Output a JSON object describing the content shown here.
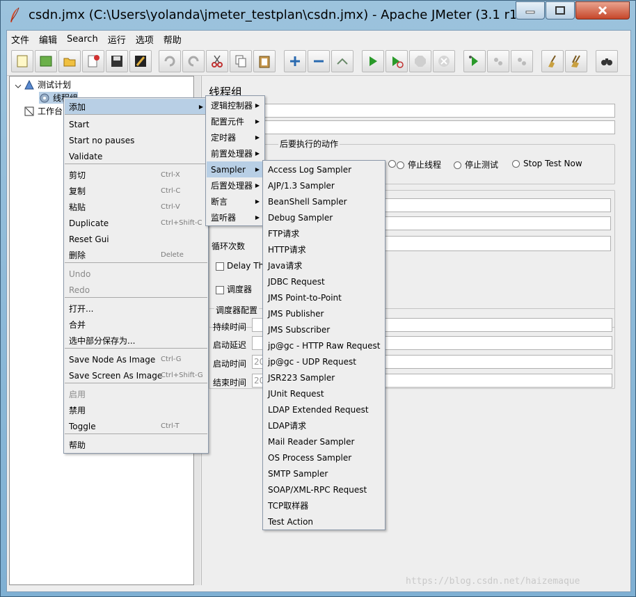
{
  "window": {
    "title": "csdn.jmx (C:\\Users\\yolanda\\jmeter_testplan\\csdn.jmx) - Apache JMeter (3.1 r17..."
  },
  "menubar": [
    "文件",
    "编辑",
    "Search",
    "运行",
    "选项",
    "帮助"
  ],
  "tree": {
    "items": [
      {
        "label": "测试计划",
        "icon": "test-plan-icon"
      },
      {
        "label": "线程组",
        "icon": "gear-icon"
      },
      {
        "label": "工作台",
        "icon": "workbench-icon"
      }
    ]
  },
  "panel": {
    "title": "线程组",
    "error_action_label": "后要执行的动作",
    "radio_options": [
      "停止线程",
      "停止测试",
      "Stop Test Now"
    ],
    "loop_label": "循环次数",
    "delay_label": "Delay Thr",
    "scheduler_label": "调度器",
    "scheduler_config": "调度器配置",
    "duration_label": "持续时间（秒",
    "startup_delay_label": "启动延迟（秒",
    "start_time_label": "启动时间",
    "start_time_value": "20",
    "end_time_label": "结束时间",
    "end_time_value": "20"
  },
  "context_menu": {
    "items": [
      {
        "label": "添加",
        "sc": "",
        "arrow": true,
        "hl": true
      },
      {
        "label": "Start",
        "sc": ""
      },
      {
        "label": "Start no pauses",
        "sc": ""
      },
      {
        "label": "Validate",
        "sc": ""
      },
      {
        "label": "剪切",
        "sc": "Ctrl-X"
      },
      {
        "label": "复制",
        "sc": "Ctrl-C"
      },
      {
        "label": "粘贴",
        "sc": "Ctrl-V"
      },
      {
        "label": "Duplicate",
        "sc": "Ctrl+Shift-C"
      },
      {
        "label": "Reset Gui",
        "sc": ""
      },
      {
        "label": "删除",
        "sc": "Delete"
      },
      {
        "label": "Undo",
        "sc": "",
        "disabled": true
      },
      {
        "label": "Redo",
        "sc": "",
        "disabled": true
      },
      {
        "label": "打开...",
        "sc": ""
      },
      {
        "label": "合并",
        "sc": ""
      },
      {
        "label": "选中部分保存为...",
        "sc": ""
      },
      {
        "label": "Save Node As Image",
        "sc": "Ctrl-G"
      },
      {
        "label": "Save Screen As Image",
        "sc": "Ctrl+Shift-G"
      },
      {
        "label": "启用",
        "sc": "",
        "disabled": true
      },
      {
        "label": "禁用",
        "sc": ""
      },
      {
        "label": "Toggle",
        "sc": "Ctrl-T"
      },
      {
        "label": "帮助",
        "sc": ""
      }
    ]
  },
  "add_submenu": {
    "items": [
      "逻辑控制器",
      "配置元件",
      "定时器",
      "前置处理器",
      "Sampler",
      "后置处理器",
      "断言",
      "监听器"
    ]
  },
  "sampler_submenu": {
    "items": [
      "Access Log Sampler",
      "AJP/1.3 Sampler",
      "BeanShell Sampler",
      "Debug Sampler",
      "FTP请求",
      "HTTP请求",
      "Java请求",
      "JDBC Request",
      "JMS Point-to-Point",
      "JMS Publisher",
      "JMS Subscriber",
      "jp@gc - HTTP Raw Request",
      "jp@gc - UDP Request",
      "JSR223 Sampler",
      "JUnit Request",
      "LDAP Extended Request",
      "LDAP请求",
      "Mail Reader Sampler",
      "OS Process Sampler",
      "SMTP Sampler",
      "SOAP/XML-RPC Request",
      "TCP取样器",
      "Test Action"
    ]
  },
  "watermark": "https://blog.csdn.net/haizemaque"
}
